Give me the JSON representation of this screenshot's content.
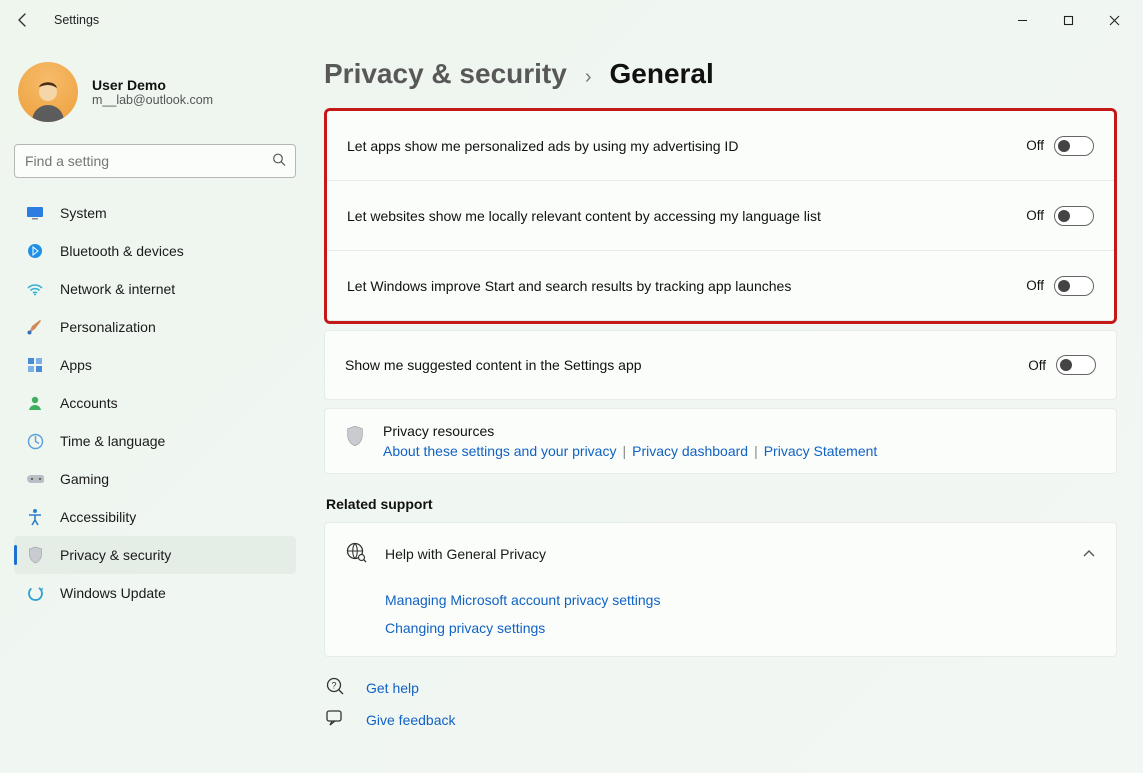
{
  "window": {
    "title": "Settings"
  },
  "user": {
    "name": "User Demo",
    "email": "m__lab@outlook.com"
  },
  "search": {
    "placeholder": "Find a setting"
  },
  "nav": {
    "items": [
      {
        "label": "System"
      },
      {
        "label": "Bluetooth & devices"
      },
      {
        "label": "Network & internet"
      },
      {
        "label": "Personalization"
      },
      {
        "label": "Apps"
      },
      {
        "label": "Accounts"
      },
      {
        "label": "Time & language"
      },
      {
        "label": "Gaming"
      },
      {
        "label": "Accessibility"
      },
      {
        "label": "Privacy & security"
      },
      {
        "label": "Windows Update"
      }
    ]
  },
  "breadcrumb": {
    "parent": "Privacy & security",
    "current": "General"
  },
  "settings": {
    "ads": {
      "label": "Let apps show me personalized ads by using my advertising ID",
      "state": "Off"
    },
    "language": {
      "label": "Let websites show me locally relevant content by accessing my language list",
      "state": "Off"
    },
    "tracking": {
      "label": "Let Windows improve Start and search results by tracking app launches",
      "state": "Off"
    },
    "suggested": {
      "label": "Show me suggested content in the Settings app",
      "state": "Off"
    }
  },
  "resources": {
    "title": "Privacy resources",
    "links": {
      "about": "About these settings and your privacy",
      "dashboard": "Privacy dashboard",
      "statement": "Privacy Statement"
    }
  },
  "related": {
    "header": "Related support",
    "help_title": "Help with General Privacy",
    "links": {
      "manage": "Managing Microsoft account privacy settings",
      "change": "Changing privacy settings"
    }
  },
  "footer": {
    "get_help": "Get help",
    "feedback": "Give feedback"
  }
}
